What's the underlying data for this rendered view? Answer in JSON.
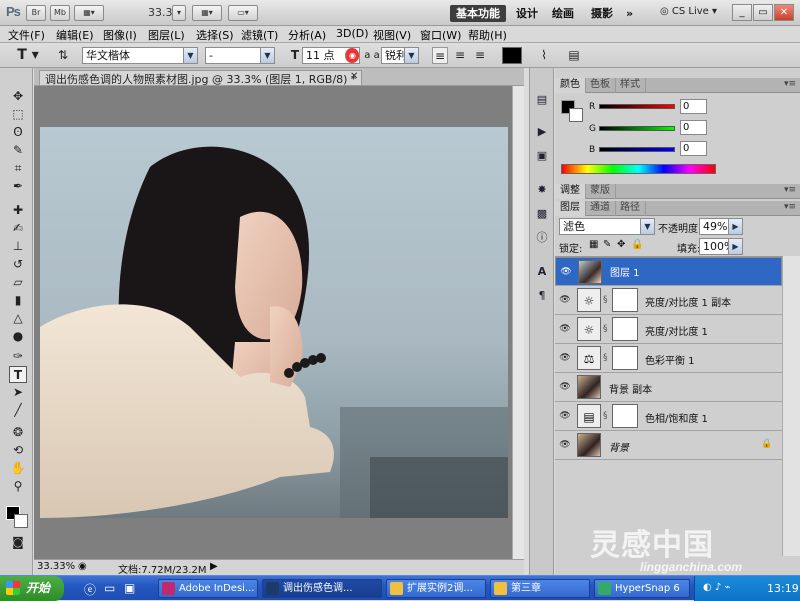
{
  "appbar": {
    "logo": "Ps",
    "btn_br": "Br",
    "btn_mb": "Mb",
    "zoom": "33.3",
    "workspaces": [
      "基本功能",
      "设计",
      "绘画",
      "摄影"
    ],
    "more": "»",
    "cs_live": "CS Live"
  },
  "menu": [
    "文件(F)",
    "编辑(E)",
    "图像(I)",
    "图层(L)",
    "选择(S)",
    "滤镜(T)",
    "分析(A)",
    "3D(D)",
    "视图(V)",
    "窗口(W)",
    "帮助(H)"
  ],
  "options": {
    "font_family": "华文楷体",
    "font_style": "-",
    "font_size": "11 点",
    "aa_label": "a a",
    "antialias": "锐利"
  },
  "document": {
    "tab_title": "调出伤感色调的人物照素材图.jpg @ 33.3% (图层 1, RGB/8) *",
    "zoom": "33.33%",
    "doc_size": "文档:7.72M/23.2M"
  },
  "color_panel": {
    "tabs": [
      "颜色",
      "色板",
      "样式"
    ],
    "channels": [
      {
        "label": "R",
        "value": "0"
      },
      {
        "label": "G",
        "value": "0"
      },
      {
        "label": "B",
        "value": "0"
      }
    ]
  },
  "adjust_panel": {
    "tabs": [
      "调整",
      "蒙版"
    ]
  },
  "layers_panel": {
    "tabs": [
      "图层",
      "通道",
      "路径"
    ],
    "blend_mode": "滤色",
    "opacity_label": "不透明度:",
    "opacity": "49%",
    "lock_label": "锁定:",
    "fill_label": "填充:",
    "fill": "100%",
    "layers": [
      {
        "name": "图层 1",
        "type": "photo",
        "selected": true
      },
      {
        "name": "亮度/对比度 1 副本",
        "type": "adjust",
        "icon": "☼"
      },
      {
        "name": "亮度/对比度 1",
        "type": "adjust",
        "icon": "☼"
      },
      {
        "name": "色彩平衡 1",
        "type": "adjust",
        "icon": "⚖"
      },
      {
        "name": "背景 副本",
        "type": "photo"
      },
      {
        "name": "色相/饱和度 1",
        "type": "adjust",
        "icon": "▤"
      },
      {
        "name": "背景",
        "type": "photo",
        "locked": true
      }
    ]
  },
  "taskbar": {
    "start": "开始",
    "tasks": [
      "Adobe InDesi...",
      "调出伤感色调...",
      "扩展实例2调...",
      "第三章",
      "HyperSnap 6"
    ],
    "clock": "13:19"
  },
  "watermark": {
    "cn": "灵感中国",
    "url": "lingganchina.com"
  },
  "colors": {
    "selection": "#2f67c4",
    "taskbar": "#2458c0",
    "photoshop_bg": "#7f7f7f"
  }
}
